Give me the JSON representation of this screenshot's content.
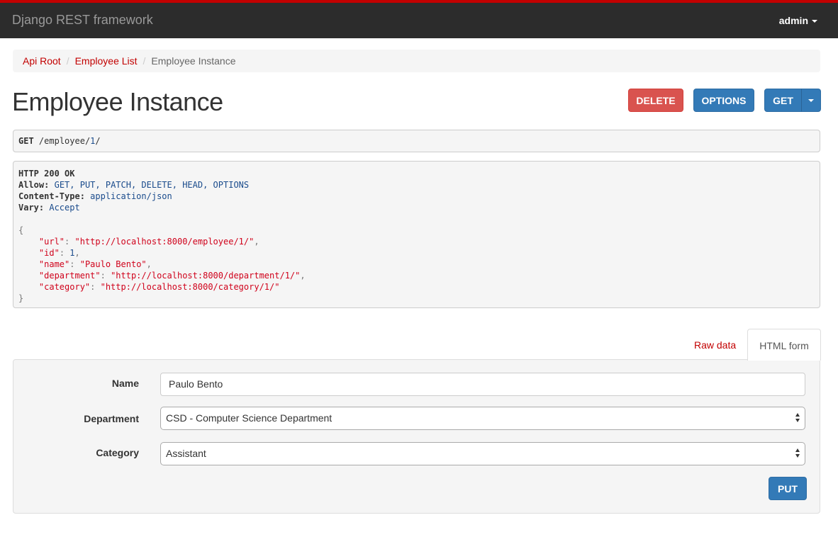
{
  "navbar": {
    "brand": "Django REST framework",
    "user": "admin"
  },
  "breadcrumb": {
    "items": [
      "Api Root",
      "Employee List",
      "Employee Instance"
    ],
    "separator": "/"
  },
  "page": {
    "title": "Employee Instance"
  },
  "actions": {
    "delete_label": "DELETE",
    "options_label": "OPTIONS",
    "get_label": "GET"
  },
  "request": {
    "method": "GET",
    "path_prefix": "/employee/",
    "path_id": "1",
    "path_suffix": "/"
  },
  "response": {
    "status": "HTTP 200 OK",
    "headers": [
      {
        "name": "Allow:",
        "value": "GET, PUT, PATCH, DELETE, HEAD, OPTIONS"
      },
      {
        "name": "Content-Type:",
        "value": "application/json"
      },
      {
        "name": "Vary:",
        "value": "Accept"
      }
    ],
    "open_brace": "{",
    "close_brace": "}",
    "body": [
      {
        "key": "\"url\"",
        "value": "\"http://localhost:8000/employee/1/\"",
        "type": "str",
        "trail": ","
      },
      {
        "key": "\"id\"",
        "value": "1",
        "type": "num",
        "trail": ","
      },
      {
        "key": "\"name\"",
        "value": "\"Paulo Bento\"",
        "type": "str",
        "trail": ","
      },
      {
        "key": "\"department\"",
        "value": "\"http://localhost:8000/department/1/\"",
        "type": "str",
        "trail": ","
      },
      {
        "key": "\"category\"",
        "value": "\"http://localhost:8000/category/1/\"",
        "type": "str",
        "trail": ""
      }
    ]
  },
  "tabs": {
    "raw": "Raw data",
    "html": "HTML form"
  },
  "form": {
    "name_label": "Name",
    "name_value": "Paulo Bento",
    "department_label": "Department",
    "department_value": "CSD - Computer Science Department",
    "category_label": "Category",
    "category_value": "Assistant",
    "submit_label": "PUT"
  },
  "colors": {
    "accent": "#c20000",
    "primary": "#337ab7",
    "danger": "#d9534f",
    "navbar": "#2c2c2c"
  }
}
